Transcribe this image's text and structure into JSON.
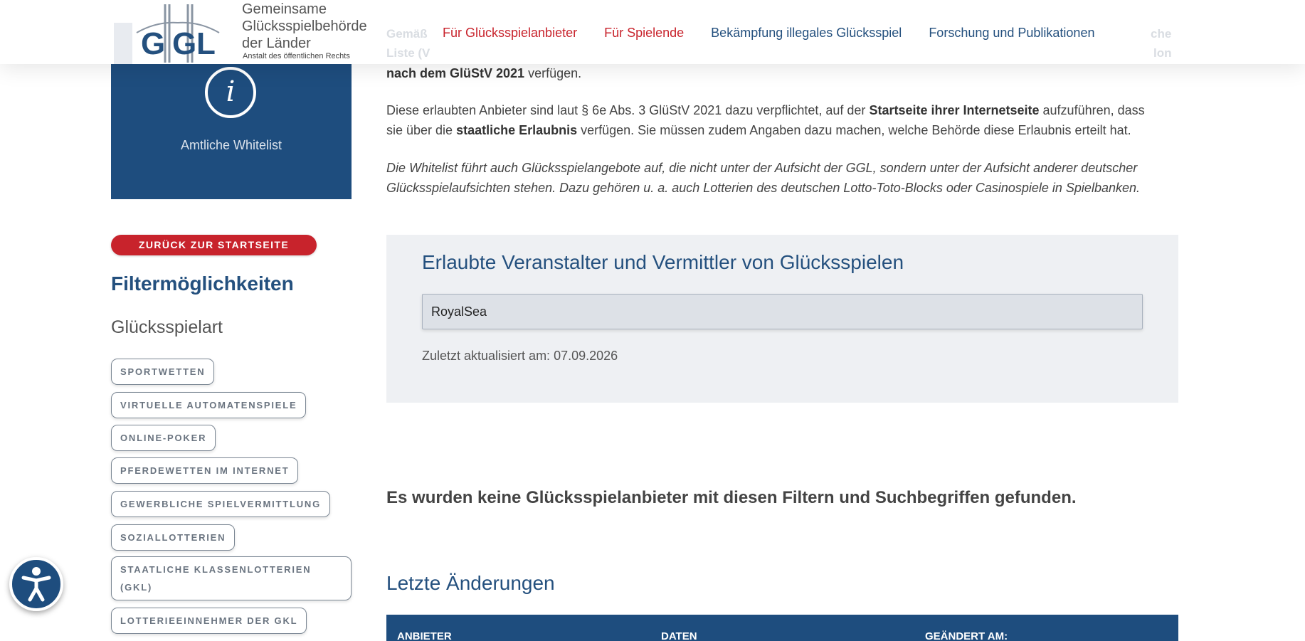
{
  "header": {
    "logo": {
      "abbr": "GGL",
      "name_lines": [
        "Gemeinsame",
        "Glücksspielbehörde",
        "der Länder"
      ],
      "subtitle": "Anstalt des öffentlichen Rechts"
    },
    "nav": [
      {
        "label": "Für Glücksspielanbieter",
        "color": "#c8232c"
      },
      {
        "label": "Für Spielende",
        "color": "#c8232c"
      },
      {
        "label": "Bekämpfung illegales Glücksspiel",
        "color": "#24507e"
      },
      {
        "label": "Forschung und Publikationen",
        "color": "#24507e"
      }
    ]
  },
  "sidebar": {
    "whitelist_card_label": "Amtliche Whitelist",
    "back_button": "ZURÜCK ZUR STARTSEITE",
    "filter_title": "Filtermöglichkeiten",
    "game_type_title": "Glücksspielart",
    "tags": [
      "SPORTWETTEN",
      "VIRTUELLE AUTOMATENSPIELE",
      "ONLINE-POKER",
      "PFERDEWETTEN IM INTERNET",
      "GEWERBLICHE SPIELVERMITTLUNG",
      "SOZIALLOTTERIEN",
      "STAATLICHE KLASSENLOTTERIEN (GKL)",
      "LOTTERIEEINNEHMER DER GKL"
    ]
  },
  "main": {
    "intro_ghost": [
      "Gemäß",
      "Liste (V",
      "che",
      "lon"
    ],
    "para1_bold": "nach dem GlüStV 2021",
    "para1_rest": " verfügen.",
    "para2_line1_a": "Diese erlaubten Anbieter sind laut § 6e Abs. 3 GlüStV 2021 dazu verpflichtet, auf der ",
    "para2_line1_b": "Startseite ihrer Internetseite",
    "para2_line1_c": " aufzuführen, dass",
    "para2_line2_a": "sie über die ",
    "para2_line2_b": "staatliche Erlaubnis",
    "para2_line2_c": " verfügen. Sie müssen zudem Angaben dazu machen, welche Behörde diese Erlaubnis erteilt hat.",
    "para3_line1": "Die Whitelist führt auch Glücksspielangebote auf, die nicht unter der Aufsicht der GGL, sondern unter der Aufsicht anderer deutscher",
    "para3_line2": "Glücksspielaufsichten stehen. Dazu gehören u. a. auch Lotterien des deutschen Lotto-Toto-Blocks oder Casinospiele in Spielbanken.",
    "search": {
      "title": "Erlaubte Veranstalter und Vermittler von Glücksspielen",
      "value": "RoyalSea",
      "updated": "Zuletzt aktualisiert am: 07.09.2026"
    },
    "no_results": "Es wurden keine Glücksspielanbieter mit diesen Filtern und Suchbegriffen gefunden.",
    "changes_title": "Letzte Änderungen",
    "table_headers": [
      "ANBIETER",
      "DATEN",
      "GEÄNDERT AM:"
    ]
  },
  "colors": {
    "brand_blue": "#1e4d7e",
    "accent_red": "#c8232c",
    "heading_blue": "#24507e"
  }
}
